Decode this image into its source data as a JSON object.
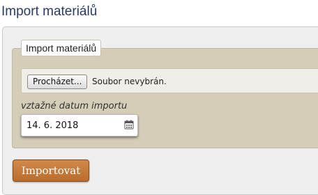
{
  "page": {
    "title": "Import materiálů"
  },
  "form": {
    "legend": "Import materiálů",
    "file": {
      "button_label": "Procházet...",
      "status": "Soubor nevybrán."
    },
    "date": {
      "label": "vztažné datum importu",
      "value": "14. 6. 2018",
      "icon": "calendar-icon"
    },
    "submit_label": "Importovat"
  },
  "colors": {
    "title": "#2b3a66",
    "fieldset_bg": "#d4cdb8",
    "submit_bg": "#c47a3b"
  }
}
